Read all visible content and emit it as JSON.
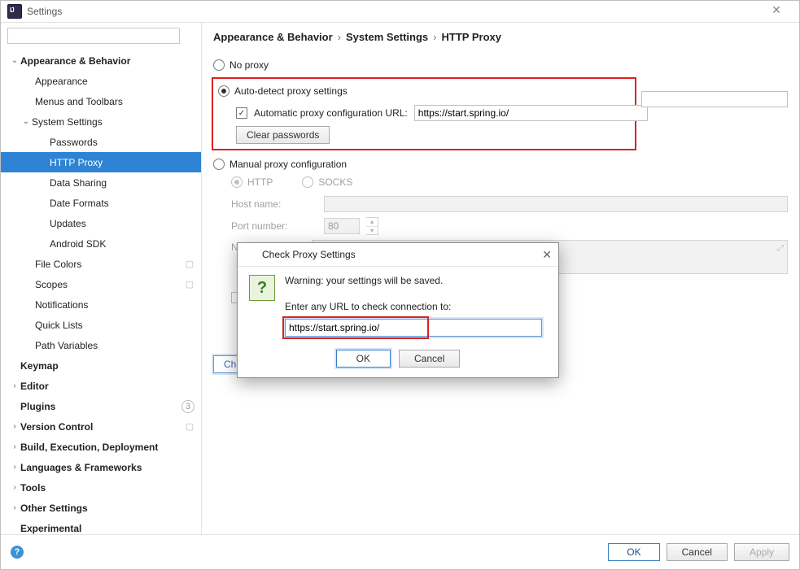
{
  "window": {
    "title": "Settings"
  },
  "search": {
    "placeholder": ""
  },
  "sidebar": {
    "appearance_behavior": "Appearance & Behavior",
    "appearance": "Appearance",
    "menus_toolbars": "Menus and Toolbars",
    "system_settings": "System Settings",
    "passwords": "Passwords",
    "http_proxy": "HTTP Proxy",
    "data_sharing": "Data Sharing",
    "date_formats": "Date Formats",
    "updates": "Updates",
    "android_sdk": "Android SDK",
    "file_colors": "File Colors",
    "scopes": "Scopes",
    "notifications": "Notifications",
    "quick_lists": "Quick Lists",
    "path_variables": "Path Variables",
    "keymap": "Keymap",
    "editor": "Editor",
    "plugins": "Plugins",
    "plugins_count": "3",
    "version_control": "Version Control",
    "build": "Build, Execution, Deployment",
    "languages": "Languages & Frameworks",
    "tools": "Tools",
    "other_settings": "Other Settings",
    "experimental": "Experimental"
  },
  "breadcrumb": {
    "a": "Appearance & Behavior",
    "b": "System Settings",
    "c": "HTTP Proxy"
  },
  "proxy": {
    "no_proxy": "No proxy",
    "auto_detect": "Auto-detect proxy settings",
    "pac_checkbox": "Automatic proxy configuration URL:",
    "pac_url": "https://start.spring.io/",
    "clear_passwords": "Clear passwords",
    "manual": "Manual proxy configuration",
    "http": "HTTP",
    "socks": "SOCKS",
    "host_label": "Host name:",
    "host_value": "",
    "port_label": "Port number:",
    "port_value": "80",
    "noproxy_label_first": "N",
    "auth_label": "",
    "remember_label": "",
    "check_connection": "Check connection"
  },
  "dialog": {
    "title": "Check Proxy Settings",
    "warning": "Warning: your settings will be saved.",
    "prompt": "Enter any URL to check connection to:",
    "url": "https://start.spring.io/",
    "ok": "OK",
    "cancel": "Cancel"
  },
  "buttons": {
    "ok": "OK",
    "cancel": "Cancel",
    "apply": "Apply"
  }
}
